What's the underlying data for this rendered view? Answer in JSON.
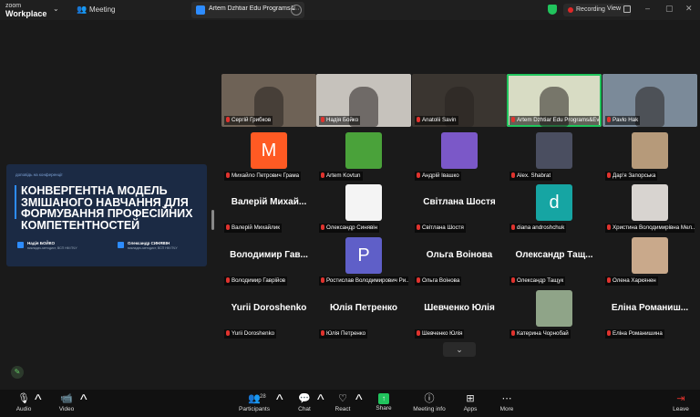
{
  "app": {
    "brand_top": "zoom",
    "brand_bottom": "Workplace",
    "menu_label": "Meeting"
  },
  "tab": {
    "title": "Artem Dzhtiar Edu Programs&Eve"
  },
  "recording": {
    "label": "Recording",
    "view_label": "View"
  },
  "slide": {
    "kicker": "доповідь на конференції",
    "title": "КОНВЕРГЕНТНА МОДЕЛЬ ЗМІШАНОГО НАВЧАННЯ ДЛЯ ФОРМУВАННЯ ПРОФЕСІЙНИХ КОМПЕТЕНТНОСТЕЙ",
    "author1": {
      "name": "Надія БОЙКО",
      "role": "викладач-методист, ВСП НМ ПЧУ"
    },
    "author2": {
      "name": "Олександр СИНЯВІН",
      "role": "викладач-методист, ВСП НМ ПЧУ"
    }
  },
  "participants": [
    {
      "name": "Сергій Грибков",
      "kind": "video",
      "bg": "#6e6256"
    },
    {
      "name": "Надія Бойко",
      "kind": "video",
      "bg": "#c6c2bc"
    },
    {
      "name": "Anatolii Savin",
      "kind": "video",
      "bg": "#3a3530"
    },
    {
      "name": "Artem Dzhtiar Edu Programs&Eve",
      "kind": "video",
      "bg": "#d8dcc4",
      "active": true
    },
    {
      "name": "Pavlo Hak",
      "kind": "video",
      "bg": "#7b8a99"
    },
    {
      "name": "Михайло Петрович Грама",
      "kind": "avatar",
      "letter": "M",
      "color": "#ff5a23"
    },
    {
      "name": "Artem Kovtun",
      "kind": "avatar",
      "color": "#4aa23a"
    },
    {
      "name": "Андрій Івашко",
      "kind": "avatar",
      "color": "#7b58c8"
    },
    {
      "name": "Alex. Shabrat",
      "kind": "avatar",
      "color": "#4a4e60"
    },
    {
      "name": "Дар'я Запорська",
      "kind": "avatar",
      "color": "#b69a7a"
    },
    {
      "name": "Валерій Михайлик",
      "kind": "text",
      "display": "Валерій Михай..."
    },
    {
      "name": "Олександр Синявін",
      "kind": "avatar",
      "color": "#f4f4f4"
    },
    {
      "name": "Світлана Шостя",
      "kind": "text",
      "display": "Світлана Шостя"
    },
    {
      "name": "diana androshchuk",
      "kind": "avatar",
      "letter": "d",
      "color": "#16a5a3"
    },
    {
      "name": "Христина Володимирівна Мел...",
      "kind": "avatar",
      "color": "#d8d4d0"
    },
    {
      "name": "Володимир Гаврійов",
      "kind": "text",
      "display": "Володимир Гав..."
    },
    {
      "name": "Ростислав Володимирович Ри...",
      "kind": "avatar",
      "letter": "P",
      "color": "#5f5fc8"
    },
    {
      "name": "Ольга Воінова",
      "kind": "text",
      "display": "Ольга Воінова"
    },
    {
      "name": "Олександр Тащук",
      "kind": "text",
      "display": "Олександр Тащ..."
    },
    {
      "name": "Олена Харкянен",
      "kind": "avatar",
      "color": "#c9a98b"
    },
    {
      "name": "Yurii Doroshenko",
      "kind": "text",
      "display": "Yurii Doroshenko"
    },
    {
      "name": "Юлія Петренко",
      "kind": "text",
      "display": "Юлія Петренко"
    },
    {
      "name": "Шевченко Юлія",
      "kind": "text",
      "display": "Шевченко Юлія"
    },
    {
      "name": "Катерина Чорнобай",
      "kind": "avatar",
      "color": "#8fa488"
    },
    {
      "name": "Еліна Романишина",
      "kind": "text",
      "display": "Еліна Романиш..."
    }
  ],
  "toolbar": {
    "audio": "Audio",
    "video": "Video",
    "participants": "Participants",
    "participants_count": "28",
    "chat": "Chat",
    "react": "React",
    "share": "Share",
    "meeting_info": "Meeting info",
    "apps": "Apps",
    "more": "More",
    "leave": "Leave"
  },
  "colors": {
    "accent": "#2d8cff",
    "active_speaker": "#21c45d",
    "muted": "#e0332e",
    "share": "#21c45d"
  }
}
